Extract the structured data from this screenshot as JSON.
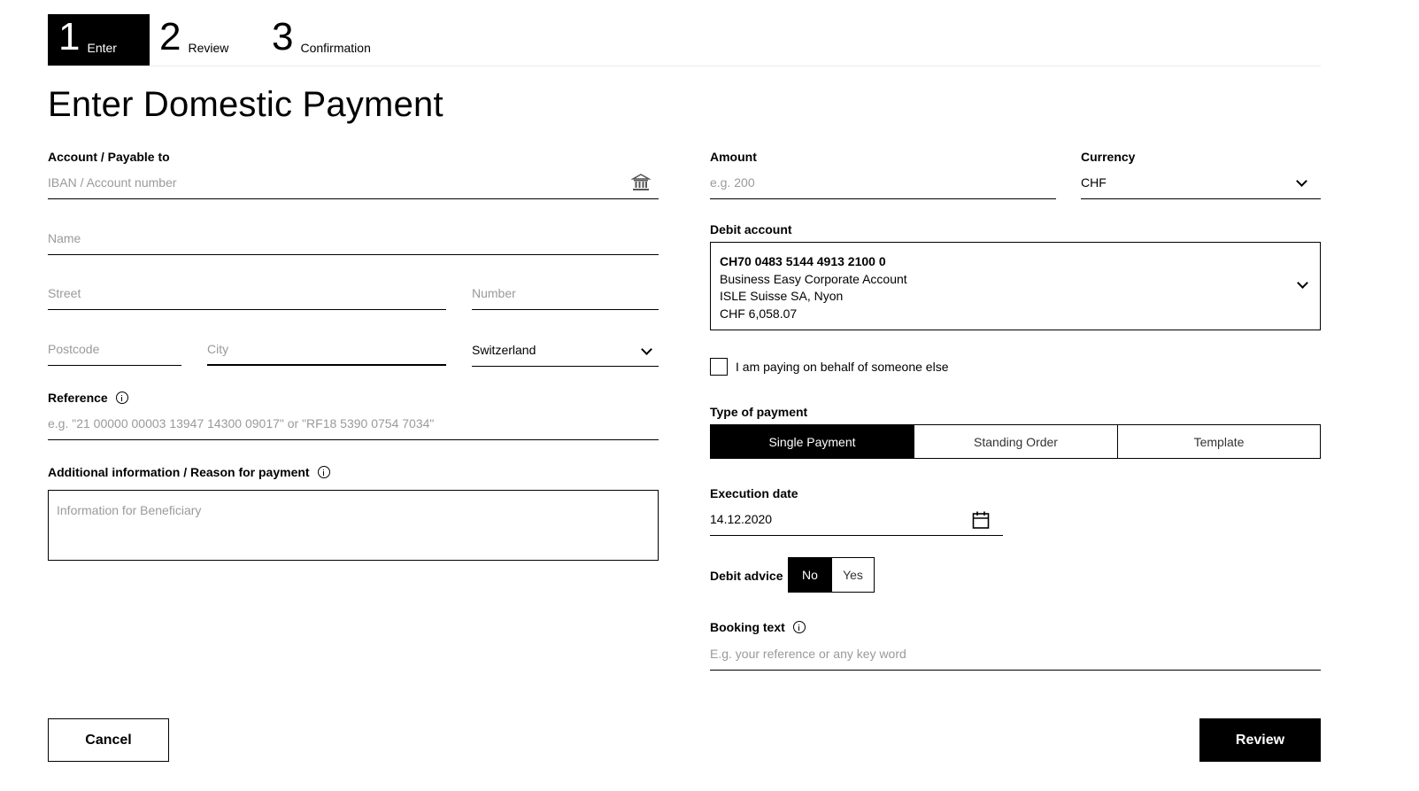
{
  "stepper": {
    "steps": [
      {
        "num": "1",
        "label": "Enter"
      },
      {
        "num": "2",
        "label": "Review"
      },
      {
        "num": "3",
        "label": "Confirmation"
      }
    ]
  },
  "page_title": "Enter Domestic Payment",
  "payee": {
    "label": "Account / Payable to",
    "account_placeholder": "IBAN / Account number",
    "name_placeholder": "Name",
    "street_placeholder": "Street",
    "number_placeholder": "Number",
    "postcode_placeholder": "Postcode",
    "city_placeholder": "City",
    "country_value": "Switzerland"
  },
  "reference": {
    "label": "Reference",
    "placeholder": "e.g. \"21 00000 00003 13947 14300 09017\" or \"RF18 5390 0754 7034\""
  },
  "additional_info": {
    "label": "Additional information / Reason for payment",
    "placeholder": "Information for Beneficiary"
  },
  "amount": {
    "label": "Amount",
    "placeholder": "e.g. 200"
  },
  "currency": {
    "label": "Currency",
    "value": "CHF"
  },
  "debit_account": {
    "label": "Debit account",
    "iban": "CH70 0483 5144 4913 2100 0",
    "account_name": "Business Easy Corporate Account",
    "holder": "ISLE Suisse SA, Nyon",
    "balance": "CHF 6,058.07"
  },
  "on_behalf": {
    "label": "I am paying on behalf of someone else"
  },
  "payment_type": {
    "label": "Type of payment",
    "options": [
      "Single Payment",
      "Standing Order",
      "Template"
    ],
    "selected": "Single Payment"
  },
  "execution_date": {
    "label": "Execution date",
    "value": "14.12.2020"
  },
  "debit_advice": {
    "label": "Debit advice",
    "no": "No",
    "yes": "Yes",
    "selected": "No"
  },
  "booking_text": {
    "label": "Booking text",
    "placeholder": "E.g. your reference or any key word"
  },
  "actions": {
    "cancel": "Cancel",
    "review": "Review"
  }
}
